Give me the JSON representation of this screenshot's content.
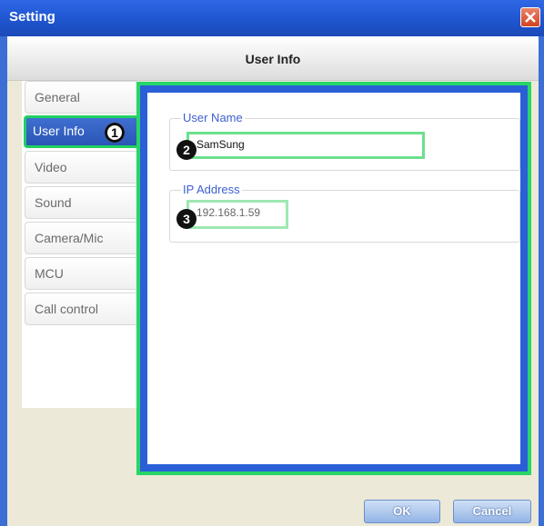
{
  "window": {
    "title": "Setting"
  },
  "page": {
    "title": "User Info"
  },
  "sidebar": {
    "items": [
      {
        "label": "General"
      },
      {
        "label": "User Info",
        "active": true
      },
      {
        "label": "Video"
      },
      {
        "label": "Sound"
      },
      {
        "label": "Camera/Mic"
      },
      {
        "label": "MCU"
      },
      {
        "label": "Call control"
      }
    ]
  },
  "callouts": [
    "1",
    "2",
    "3"
  ],
  "user_name": {
    "legend": "User Name",
    "value": "SamSung"
  },
  "ip_address": {
    "legend": "IP Address",
    "value": "192.168.1.59"
  },
  "buttons": {
    "ok": "OK",
    "cancel": "Cancel"
  },
  "colors": {
    "highlight": "#27d666",
    "titlebar": "#1f55cf",
    "accent": "#3d5fcf"
  }
}
